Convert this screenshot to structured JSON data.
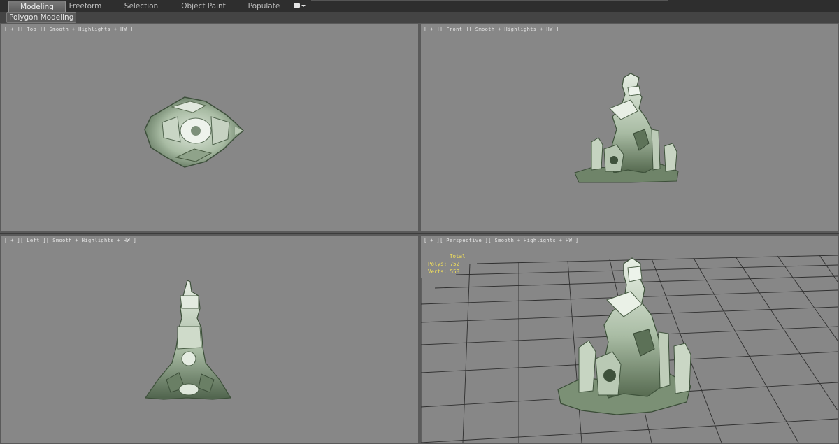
{
  "ribbon": {
    "tabs": [
      {
        "label": "Modeling",
        "active": true
      },
      {
        "label": "Freeform",
        "active": false
      },
      {
        "label": "Selection",
        "active": false
      },
      {
        "label": "Object Paint",
        "active": false
      },
      {
        "label": "Populate",
        "active": false
      }
    ],
    "options_icon": "ribbon-display-options-icon",
    "panel_label": "Polygon Modeling"
  },
  "viewports": {
    "top": {
      "label": "[ + ][ Top ][ Smooth + Highlights + HW ]"
    },
    "front": {
      "label": "[ + ][ Front ][ Smooth + Highlights + HW ]"
    },
    "left": {
      "label": "[ + ][ Left ][ Smooth + Highlights + HW ]"
    },
    "perspective": {
      "label": "[ + ][ Perspective ][ Smooth + Highlights + HW ]",
      "stats": {
        "title": "Total",
        "polys_label": "Polys:",
        "polys_value": "752",
        "verts_label": "Verts:",
        "verts_value": "558"
      }
    }
  },
  "colors": {
    "viewport_bg": "#878787",
    "rock_light": "#d9e3d6",
    "rock_mid": "#9fb39b",
    "rock_dark": "#4a5e48",
    "grid": "#2a2a2a",
    "stats_text": "#f3e05a",
    "active_tab": "#6a6a6a"
  }
}
